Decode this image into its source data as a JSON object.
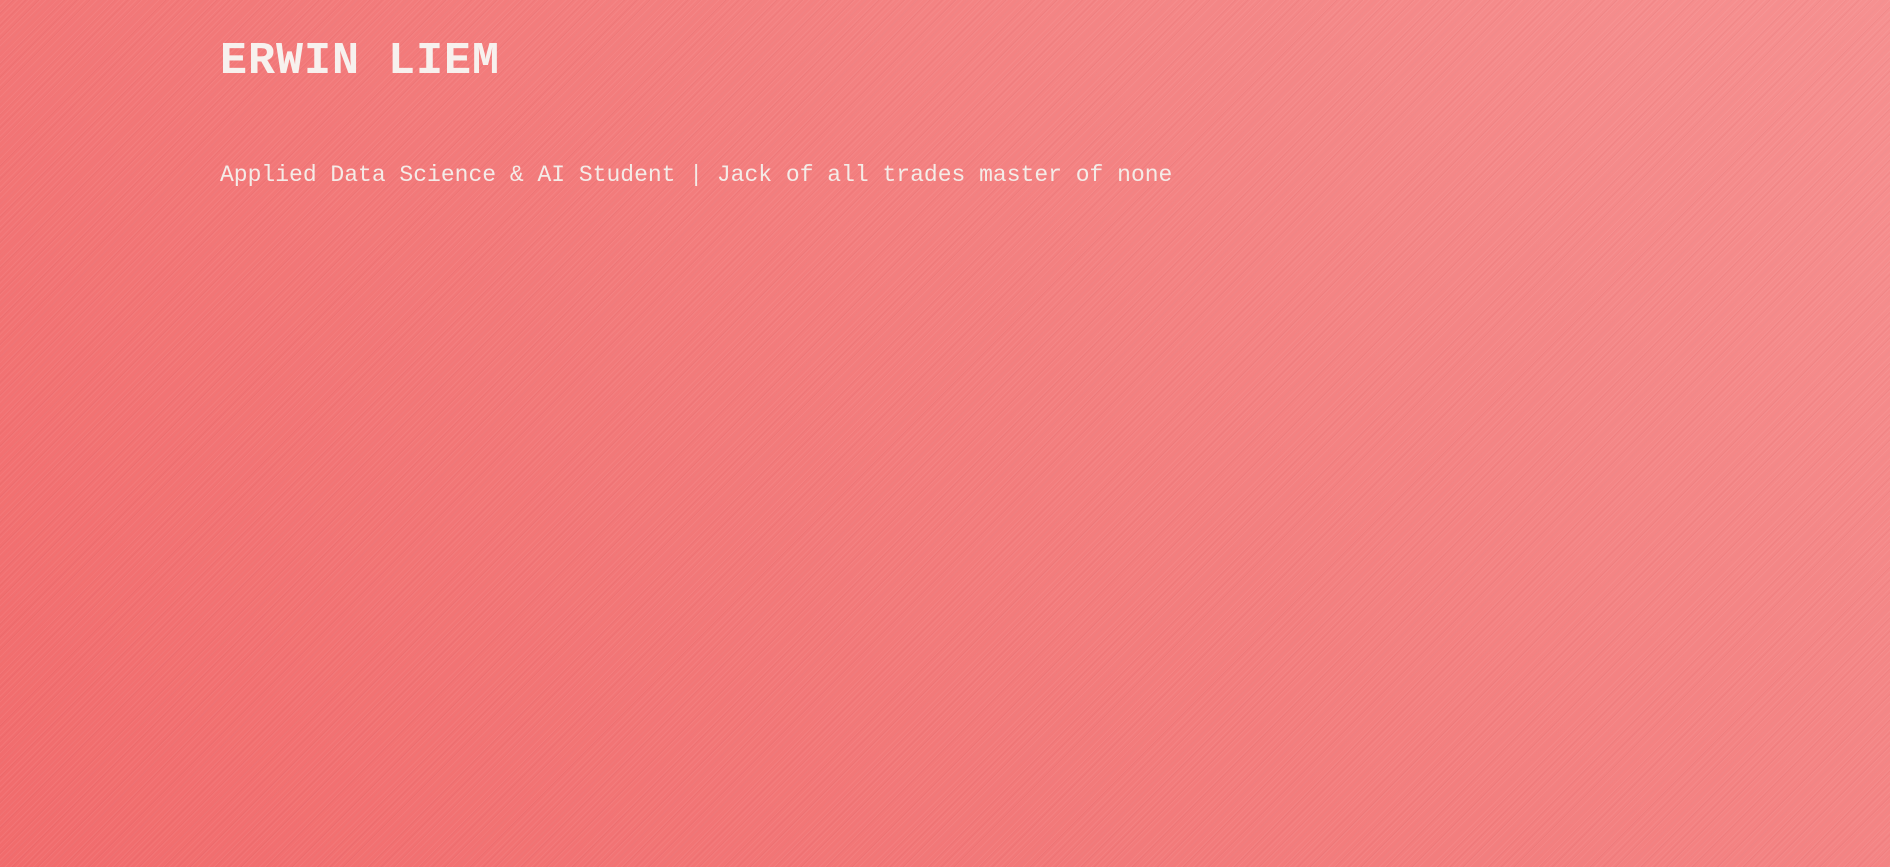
{
  "header": {
    "title": "ERWIN LIEM",
    "tagline": "Applied Data Science & AI Student | Jack of all trades master of none"
  },
  "colors": {
    "background": "#f27a7a",
    "text": "#f7f1ee"
  }
}
